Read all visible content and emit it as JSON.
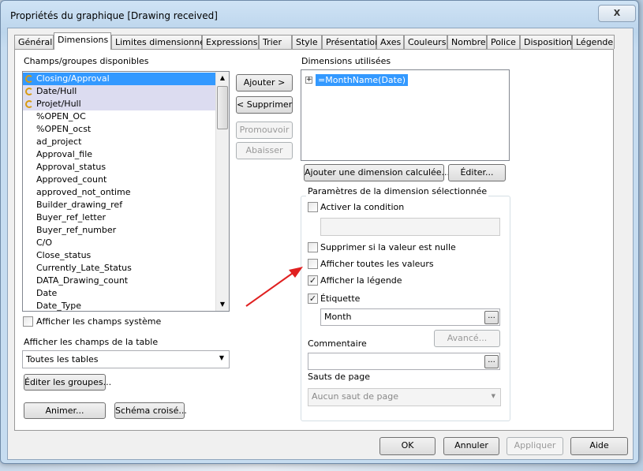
{
  "window": {
    "title": "Propriétés du graphique [Drawing received]",
    "close": "X"
  },
  "tabs": [
    "Général",
    "Dimensions",
    "Limites dimensionnelles",
    "Expressions",
    "Trier",
    "Style",
    "Présentation",
    "Axes",
    "Couleurs",
    "Nombre",
    "Police",
    "Disposition",
    "Légende"
  ],
  "active_tab": "Dimensions",
  "available": {
    "label": "Champs/groupes disponibles",
    "items": [
      {
        "text": "Closing/Approval",
        "type": "group",
        "selected": true
      },
      {
        "text": "Date/Hull",
        "type": "group"
      },
      {
        "text": "Projet/Hull",
        "type": "group"
      },
      {
        "text": "%OPEN_OC"
      },
      {
        "text": "%OPEN_ocst"
      },
      {
        "text": "ad_project"
      },
      {
        "text": "Approval_file"
      },
      {
        "text": "Approval_status"
      },
      {
        "text": "Approved_count"
      },
      {
        "text": "approved_not_ontime"
      },
      {
        "text": "Builder_drawing_ref"
      },
      {
        "text": "Buyer_ref_letter"
      },
      {
        "text": "Buyer_ref_number"
      },
      {
        "text": "C/O"
      },
      {
        "text": "Close_status"
      },
      {
        "text": "Currently_Late_Status"
      },
      {
        "text": "DATA_Drawing_count"
      },
      {
        "text": "Date"
      },
      {
        "text": "Date_Type"
      }
    ],
    "show_system": "Afficher les champs système",
    "show_system_checked": false,
    "table_label": "Afficher les champs de la table",
    "table_value": "Toutes les tables",
    "edit_groups": "Éditer les groupes...",
    "animate": "Animer...",
    "cross": "Schéma croisé..."
  },
  "mid_buttons": {
    "add": "Ajouter >",
    "remove": "< Supprimer",
    "promote": "Promouvoir",
    "demote": "Abaisser"
  },
  "used": {
    "label": "Dimensions utilisées",
    "items": [
      "=MonthName(Date)"
    ],
    "add_calc": "Ajouter une dimension calculée......",
    "edit": "Éditer..."
  },
  "params": {
    "label": "Paramètres de la dimension sélectionnée",
    "condition": "Activer la condition",
    "condition_checked": false,
    "condition_value": "",
    "suppress_null": "Supprimer si la valeur est nulle",
    "suppress_null_checked": false,
    "show_all": "Afficher toutes les valeurs",
    "show_all_checked": false,
    "show_legend": "Afficher la légende",
    "show_legend_checked": true,
    "label_cb": "Étiquette",
    "label_checked": true,
    "label_value": "Month",
    "comment": "Commentaire",
    "comment_value": "",
    "advanced": "Avancé...",
    "page_breaks": "Sauts de page",
    "page_breaks_value": "Aucun saut de page",
    "dots": "..."
  },
  "footer": {
    "ok": "OK",
    "cancel": "Annuler",
    "apply": "Appliquer",
    "help": "Aide"
  },
  "colors": {
    "selection": "#3399ff",
    "group_bg": "#dcdcf0",
    "arrow": "#e02020"
  }
}
